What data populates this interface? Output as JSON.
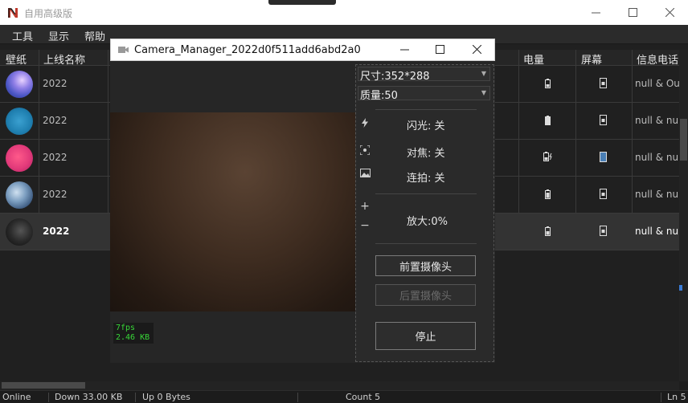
{
  "app": {
    "title": "自用高级版",
    "menu": [
      "工具",
      "显示",
      "帮助"
    ]
  },
  "table": {
    "columns": [
      "壁纸",
      "上线名称",
      "电量",
      "屏幕",
      "信息电话"
    ],
    "rows": [
      {
        "date": "2022",
        "info": "null & Out"
      },
      {
        "date": "2022",
        "info": "null & null"
      },
      {
        "date": "2022",
        "info": "null & null"
      },
      {
        "date": "2022",
        "info": "null & null"
      },
      {
        "date": "2022",
        "info": "null & null"
      }
    ]
  },
  "camera": {
    "title": "Camera_Manager_2022d0f511add6abd2a0",
    "fps": "7fps",
    "bytes": "2.46 KB",
    "size_select": "尺寸:352*288",
    "quality_select": "质量:50",
    "flash": "闪光: 关",
    "focus": "对焦: 关",
    "burst": "连拍: 关",
    "zoom": "放大:0%",
    "front_camera": "前置摄像头",
    "back_camera": "后置摄像头",
    "stop": "停止"
  },
  "status": {
    "online": "Online",
    "down": "Down 33.00 KB",
    "up": "Up 0 Bytes",
    "count": "Count 5",
    "line": "Ln 5"
  },
  "colors": {
    "background": "#1e1e1e",
    "selected_row": "#333333",
    "fps_text": "#38d638"
  }
}
